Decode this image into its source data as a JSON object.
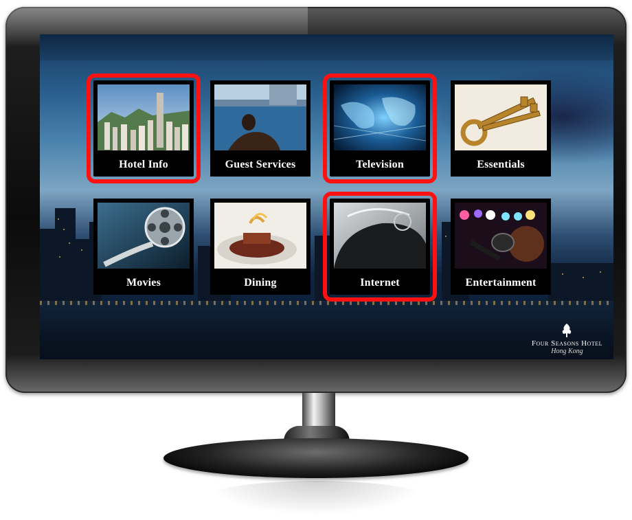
{
  "screen": {
    "tiles": [
      {
        "label": "Hotel Info",
        "highlighted": true
      },
      {
        "label": "Guest Services",
        "highlighted": false
      },
      {
        "label": "Television",
        "highlighted": true
      },
      {
        "label": "Essentials",
        "highlighted": false
      },
      {
        "label": "Movies",
        "highlighted": false
      },
      {
        "label": "Dining",
        "highlighted": false
      },
      {
        "label": "Internet",
        "highlighted": true
      },
      {
        "label": "Entertainment",
        "highlighted": false
      }
    ],
    "logo": {
      "name": "Four Seasons Hotel",
      "city": "Hong Kong",
      "icon": "tree-icon"
    }
  },
  "colors": {
    "highlight": "#ff1111",
    "tile_bg": "#000000",
    "label_text": "#ffffff"
  }
}
